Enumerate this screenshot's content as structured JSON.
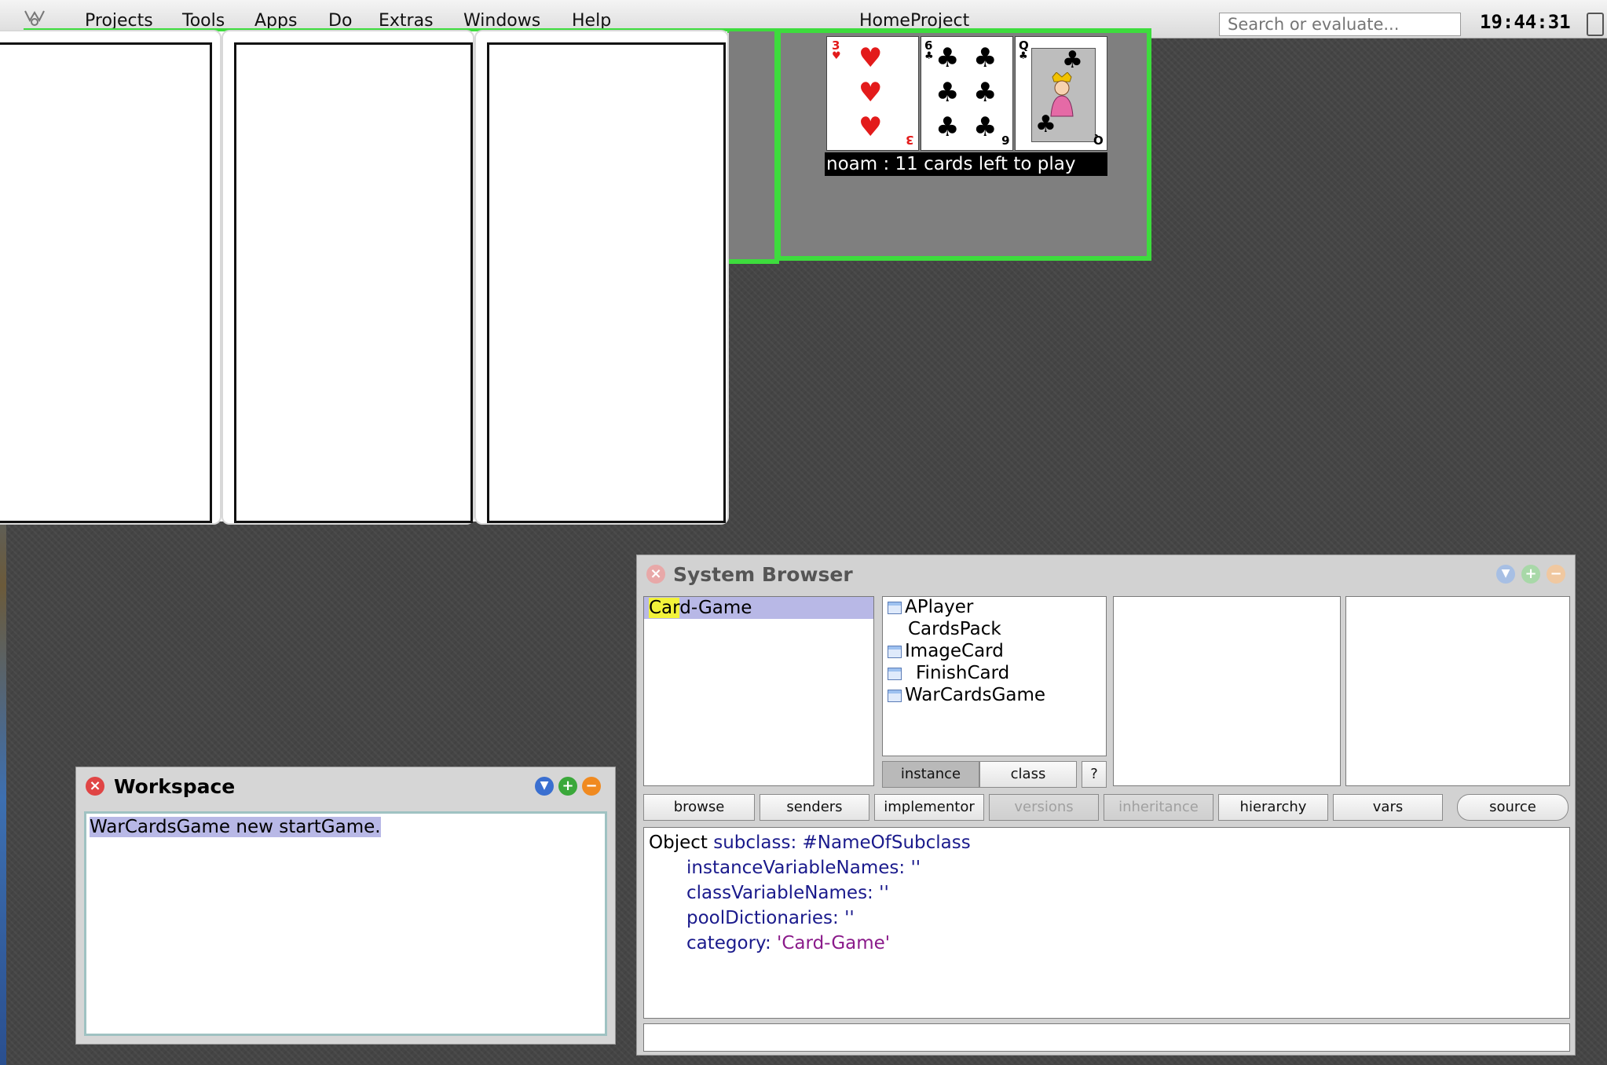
{
  "menubar": {
    "items": [
      "Projects",
      "Tools",
      "Apps",
      "Do",
      "Extras",
      "Windows",
      "Help"
    ],
    "project_title": "HomeProject",
    "search_placeholder": "Search or evaluate...",
    "clock": "19:44:31"
  },
  "game": {
    "player_status": "noam : 11 cards left to play",
    "cards": [
      {
        "rank": "3",
        "suit": "hearts",
        "color": "#e31b1b"
      },
      {
        "rank": "6",
        "suit": "clubs",
        "color": "#000000"
      },
      {
        "rank": "Q",
        "suit": "clubs",
        "color": "#000000"
      }
    ]
  },
  "system_browser": {
    "title": "System Browser",
    "categories": [
      "Card-Game"
    ],
    "category_highlight": "Car",
    "category_rest": "d-Game",
    "classes": [
      {
        "name": "APlayer",
        "icon": "class-icon"
      },
      {
        "name": "CardsPack",
        "icon": ""
      },
      {
        "name": "ImageCard",
        "icon": "class-icon"
      },
      {
        "name": "FinishCard",
        "icon": "class-icon"
      },
      {
        "name": "WarCardsGame",
        "icon": "class-icon"
      }
    ],
    "toggle": {
      "instance": "instance",
      "class": "class",
      "help": "?"
    },
    "buttons": {
      "browse": "browse",
      "senders": "senders",
      "implementor": "implementor",
      "versions": "versions",
      "inheritance": "inheritance",
      "hierarchy": "hierarchy",
      "vars": "vars",
      "source": "source"
    },
    "code": {
      "line1_a": "Object ",
      "line1_b": "subclass: #NameOfSubclass",
      "line2": "instanceVariableNames: ''",
      "line3": "classVariableNames: ''",
      "line4": "poolDictionaries: ''",
      "line5_a": "category: ",
      "line5_b": "'Card-Game'"
    }
  },
  "workspace": {
    "title": "Workspace",
    "content": "WarCardsGame new startGame."
  },
  "colors": {
    "green_border": "#3ddc3d",
    "selection": "#b8b8e6",
    "highlight": "#f2f23a",
    "keyword": "#1a1a8c",
    "string": "#8a1a8a"
  }
}
